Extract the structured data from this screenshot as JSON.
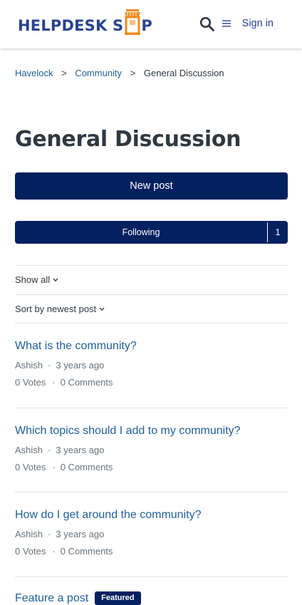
{
  "brand": {
    "name_before": "HELPDESK S",
    "name_after": "P",
    "color": "#2a4390",
    "accent": "#f08a1c"
  },
  "header": {
    "sign_in": "Sign in"
  },
  "breadcrumb": [
    {
      "label": "Havelock",
      "link": true
    },
    {
      "label": "Community",
      "link": true
    },
    {
      "label": "General Discussion",
      "link": false
    }
  ],
  "breadcrumb_sep": ">",
  "page": {
    "title": "General Discussion"
  },
  "actions": {
    "new_post": "New post",
    "following": "Following",
    "follow_count": "1"
  },
  "filters": {
    "show": "Show all",
    "sort": "Sort by newest post"
  },
  "colors": {
    "primary": "#03205f",
    "link": "#1f5f96",
    "muted": "#68737d"
  },
  "posts": [
    {
      "title": "What is the community?",
      "author": "Ashish",
      "time": "3 years ago",
      "votes": "0 Votes",
      "comments": "0 Comments"
    },
    {
      "title": "Which topics should I add to my community?",
      "author": "Ashish",
      "time": "3 years ago",
      "votes": "0 Votes",
      "comments": "0 Comments"
    },
    {
      "title": "How do I get around the community?",
      "author": "Ashish",
      "time": "3 years ago",
      "votes": "0 Votes",
      "comments": "0 Comments"
    },
    {
      "title": "Feature a post",
      "badge": "Featured"
    }
  ],
  "meta_sep": "·"
}
